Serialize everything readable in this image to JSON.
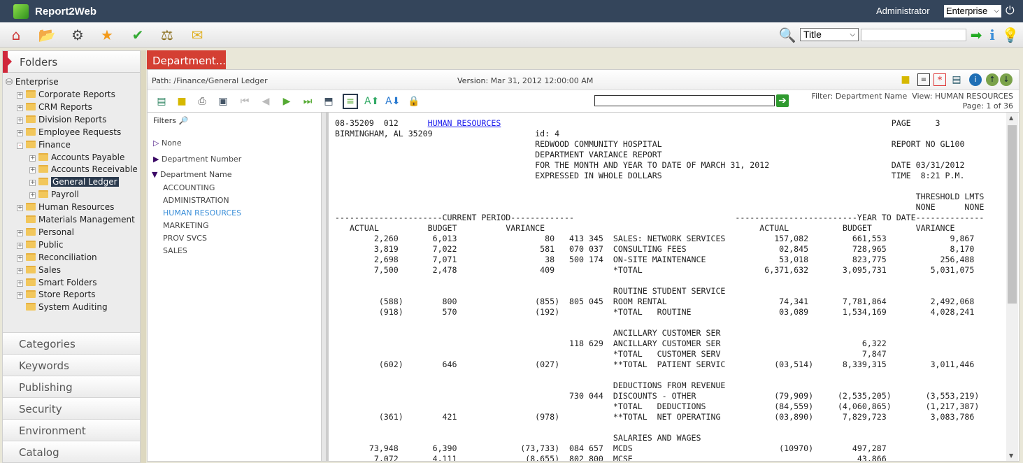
{
  "app": {
    "title": "Report2Web",
    "user": "Administrator",
    "scope": "Enterprise"
  },
  "toolbar": {
    "icons": [
      "home-icon",
      "folder-user-icon",
      "user-settings-icon",
      "favorites-star-icon",
      "approval-icon",
      "scales-icon",
      "mail-icon"
    ],
    "search_field": "Title",
    "search_value": ""
  },
  "sidebar": {
    "header": "Folders",
    "root": "Enterprise",
    "tree": [
      {
        "label": "Corporate Reports",
        "level": 1,
        "expander": "+"
      },
      {
        "label": "CRM Reports",
        "level": 1,
        "expander": "+"
      },
      {
        "label": "Division Reports",
        "level": 1,
        "expander": "+"
      },
      {
        "label": "Employee Requests",
        "level": 1,
        "expander": "+"
      },
      {
        "label": "Finance",
        "level": 1,
        "expander": "-"
      },
      {
        "label": "Accounts Payable",
        "level": 2,
        "expander": "+"
      },
      {
        "label": "Accounts Receivable",
        "level": 2,
        "expander": "+"
      },
      {
        "label": "General Ledger",
        "level": 2,
        "expander": "+",
        "selected": true
      },
      {
        "label": "Payroll",
        "level": 2,
        "expander": "+"
      },
      {
        "label": "Human Resources",
        "level": 1,
        "expander": "+"
      },
      {
        "label": "Materials Management",
        "level": 1,
        "expander": ""
      },
      {
        "label": "Personal",
        "level": 1,
        "expander": "+"
      },
      {
        "label": "Public",
        "level": 1,
        "expander": "+"
      },
      {
        "label": "Reconciliation",
        "level": 1,
        "expander": "+"
      },
      {
        "label": "Sales",
        "level": 1,
        "expander": "+"
      },
      {
        "label": "Smart Folders",
        "level": 1,
        "expander": "+"
      },
      {
        "label": "Store Reports",
        "level": 1,
        "expander": "+"
      },
      {
        "label": "System Auditing",
        "level": 1,
        "expander": ""
      }
    ],
    "sections": [
      "Categories",
      "Keywords",
      "Publishing",
      "Security",
      "Environment",
      "Catalog"
    ]
  },
  "tab": {
    "label": "Department..."
  },
  "viewer": {
    "path_label": "Path:",
    "path": "/Finance/General Ledger",
    "version_label": "Version:",
    "version": "Mar 31, 2012 12:00:00 AM",
    "filter_label": "Filter:",
    "filter": "Department Name",
    "view_label": "View:",
    "view": "HUMAN RESOURCES",
    "page_label": "Page:",
    "page": "1 of 36",
    "find_value": ""
  },
  "filters": {
    "title": "Filters",
    "none": "None",
    "groups": [
      "Department Number",
      "Department Name"
    ],
    "values": [
      "ACCOUNTING",
      "ADMINISTRATION",
      "HUMAN RESOURCES",
      "MARKETING",
      "PROV SVCS",
      "SALES"
    ],
    "active": "HUMAN RESOURCES"
  },
  "report": {
    "header": {
      "dept_code": "08-35209  012",
      "dept_link": "HUMAN RESOURCES",
      "page": "PAGE     3",
      "city": "BIRMINGHAM, AL 35209",
      "id": "id: 4",
      "org": "REDWOOD COMMUNITY HOSPITAL",
      "report_no": "REPORT NO GL100",
      "title": "DEPARTMENT VARIANCE REPORT",
      "period": "FOR THE MONTH AND YEAR TO DATE OF MARCH 31, 2012",
      "date": "DATE 03/31/2012",
      "units": "EXPRESSED IN WHOLE DOLLARS",
      "time": "TIME  8:21 P.M.",
      "threshold": "THRESHOLD LMTS",
      "threshold_a": "NONE",
      "threshold_b": "NONE",
      "current_period": "CURRENT PERIOD",
      "year_to_date": "YEAR TO DATE",
      "cols": [
        "ACTUAL",
        "BUDGET",
        "VARIANCE",
        "ACTUAL",
        "BUDGET",
        "VARIANCE"
      ]
    },
    "rows": [
      [
        "2,260",
        "6,013",
        "80",
        "413 345",
        "SALES: NETWORK SERVICES",
        "157,082",
        "661,553",
        "9,867"
      ],
      [
        "3,819",
        "7,022",
        "581",
        "070 037",
        "CONSULTING FEES",
        "02,845",
        "728,965",
        "8,170"
      ],
      [
        "2,698",
        "7,071",
        "38",
        "500 174",
        "ON-SITE MAINTENANCE",
        "53,018",
        "823,775",
        "256,488"
      ],
      [
        "7,500",
        "2,478",
        "409",
        "",
        "*TOTAL",
        "6,371,632",
        "3,095,731",
        "5,031,075"
      ],
      [],
      [
        "",
        "",
        "",
        "",
        "ROUTINE STUDENT SERVICE",
        "",
        "",
        ""
      ],
      [
        "(588)",
        "800",
        "(855)",
        "805 045",
        "ROOM RENTAL",
        "74,341",
        "7,781,864",
        "2,492,068"
      ],
      [
        "(918)",
        "570",
        "(192)",
        "",
        "*TOTAL   ROUTINE",
        "03,089",
        "1,534,169",
        "4,028,241"
      ],
      [],
      [
        "",
        "",
        "",
        "",
        "ANCILLARY CUSTOMER SER",
        "",
        "",
        ""
      ],
      [
        "",
        "",
        "",
        "118 629",
        "ANCILLARY CUSTOMER SER",
        "",
        "6,322",
        ""
      ],
      [
        "",
        "",
        "",
        "",
        "*TOTAL   CUSTOMER SERV",
        "",
        "7,847",
        ""
      ],
      [
        "(602)",
        "646",
        "(027)",
        "",
        "**TOTAL  PATIENT SERVIC",
        "(03,514)",
        "8,339,315",
        "3,011,446"
      ],
      [],
      [
        "",
        "",
        "",
        "",
        "DEDUCTIONS FROM REVENUE",
        "",
        "",
        ""
      ],
      [
        "",
        "",
        "",
        "730 044",
        "DISCOUNTS - OTHER",
        "(79,909)",
        "(2,535,205)",
        "(3,553,219)"
      ],
      [
        "",
        "",
        "",
        "",
        "*TOTAL   DEDUCTIONS",
        "(84,559)",
        "(4,060,865)",
        "(1,217,387)"
      ],
      [
        "(361)",
        "421",
        "(978)",
        "",
        "**TOTAL  NET OPERATING",
        "(03,890)",
        "7,829,723",
        "3,083,786"
      ],
      [],
      [
        "",
        "",
        "",
        "",
        "SALARIES AND WAGES",
        "",
        "",
        ""
      ],
      [
        "73,948",
        "6,390",
        "(73,733)",
        "084 657",
        "MCDS",
        "(10970)",
        "497,287",
        ""
      ],
      [
        "7,072",
        "4,111",
        "(8,655)",
        "802 800",
        "MCSE",
        "",
        "43,866",
        ""
      ]
    ]
  }
}
